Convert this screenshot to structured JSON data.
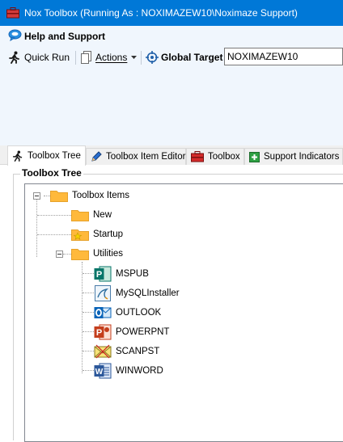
{
  "window": {
    "title": "Nox Toolbox (Running As : NOXIMAZEW10\\Noximaze Support)"
  },
  "help": {
    "label": "Help and Support"
  },
  "toolbar": {
    "quick_run": "Quick Run",
    "actions": "Actions",
    "global_target_label": "Global Target",
    "global_target_value": "NOXIMAZEW10"
  },
  "tabs": [
    {
      "label": "Toolbox Tree"
    },
    {
      "label": "Toolbox Item Editor"
    },
    {
      "label": "Toolbox"
    },
    {
      "label": "Support Indicators"
    }
  ],
  "tree": {
    "group_title": "Toolbox Tree",
    "root": "Toolbox Items",
    "folders": {
      "new": "New",
      "startup": "Startup",
      "utilities": "Utilities"
    },
    "items": [
      {
        "label": "MSPUB",
        "icon": "publisher-icon"
      },
      {
        "label": "MySQLInstaller",
        "icon": "mysql-installer-icon"
      },
      {
        "label": "OUTLOOK",
        "icon": "outlook-icon"
      },
      {
        "label": "POWERPNT",
        "icon": "powerpoint-icon"
      },
      {
        "label": "SCANPST",
        "icon": "scanpst-icon"
      },
      {
        "label": "WINWORD",
        "icon": "word-icon"
      }
    ]
  },
  "colors": {
    "titlebar": "#0078d7",
    "ribbon_background": "#f0f6fd",
    "folder": "#ffb93b"
  }
}
